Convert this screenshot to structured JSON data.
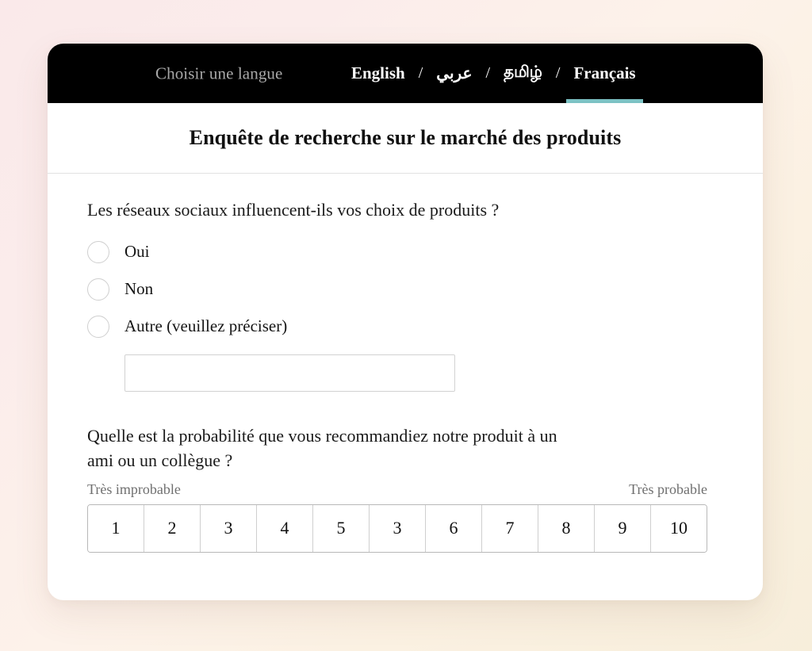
{
  "page": {
    "background_start": "#fae9ea",
    "background_end": "#f7eedb"
  },
  "langbar": {
    "prompt": "Choisir une langue",
    "separator": "/",
    "active_indicator_color": "#7cc2c4",
    "bar_color": "#000000",
    "languages": [
      {
        "label": "English",
        "active": false
      },
      {
        "label": "عربي",
        "active": false
      },
      {
        "label": "தமிழ்",
        "active": false
      },
      {
        "label": "Français",
        "active": true
      }
    ]
  },
  "header": {
    "title": "Enquête de recherche sur le marché des produits"
  },
  "questions": {
    "q1": {
      "text": "Les réseaux sociaux influencent-ils vos choix de produits ?",
      "options": [
        {
          "label": "Oui",
          "selected": false
        },
        {
          "label": "Non",
          "selected": false
        },
        {
          "label": "Autre (veuillez préciser)",
          "selected": false
        }
      ],
      "other_input": {
        "value": "",
        "placeholder": ""
      }
    },
    "q2": {
      "line1": "Quelle est la probabilité que vous recommandiez notre produit à un",
      "line2": "ami ou un collègue ?",
      "scale": {
        "left_label": "Très improbable",
        "right_label": "Très probable",
        "values": [
          "1",
          "2",
          "3",
          "4",
          "5",
          "3",
          "6",
          "7",
          "8",
          "9",
          "10"
        ],
        "selected": null
      }
    }
  }
}
